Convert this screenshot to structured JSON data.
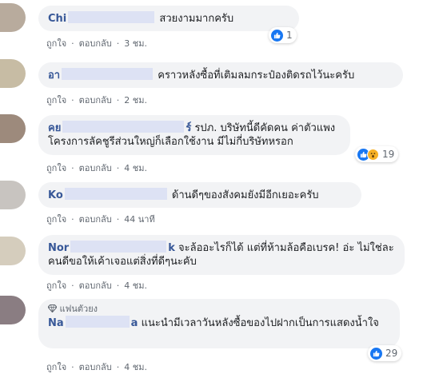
{
  "actions": {
    "like": "ถูกใจ",
    "reply": "ตอบกลับ"
  },
  "badge": "แฟนตัวยง",
  "comments": [
    {
      "name": "Chi",
      "text": "สวยงามมากครับ",
      "time": "3 ชม.",
      "reactions": "1"
    },
    {
      "name": "อา",
      "text": "คราวหลังซื้อที่เติมลมกระป๋องติดรถไว้นะครับ",
      "time": "2 ชม."
    },
    {
      "name": "คย",
      "name_tail": "ร์",
      "text": "รปภ. บริษัทนี้ดีคัดคน ค่าตัวแพง โครงการลัคชูรีส่วนใหญ่ก็เลือกใช้งาน มีไม่กี่บริษัทหรอก",
      "time": "4 ชม.",
      "reactions": "19"
    },
    {
      "name": "Ko",
      "text": "ด้านดีๆของสังคมยังมีอีกเยอะครับ",
      "time": "44 นาที"
    },
    {
      "name": "Nor",
      "name_tail": "k",
      "text": "จะล้ออะไรก็ได้ แต่ที่ห้ามล้อคือเบรค! อ่ะ ไม่ใช่ละ คนดีขอให้เค้าเจอแต่สิ่งที่ดีๆนะคับ",
      "time": "4 ชม."
    },
    {
      "name": "Na",
      "name_tail": "a",
      "text": "แนะนำมีเวลาวันหลังซื้อของไปฝากเป็นการแสดงน้ำใจ",
      "time": "4 ชม.",
      "reactions": "29"
    }
  ],
  "colors": {
    "link": "#385898",
    "bubble": "#f2f3f5",
    "like_blue": "#1877f2",
    "wow_yellow": "#f7b125"
  }
}
